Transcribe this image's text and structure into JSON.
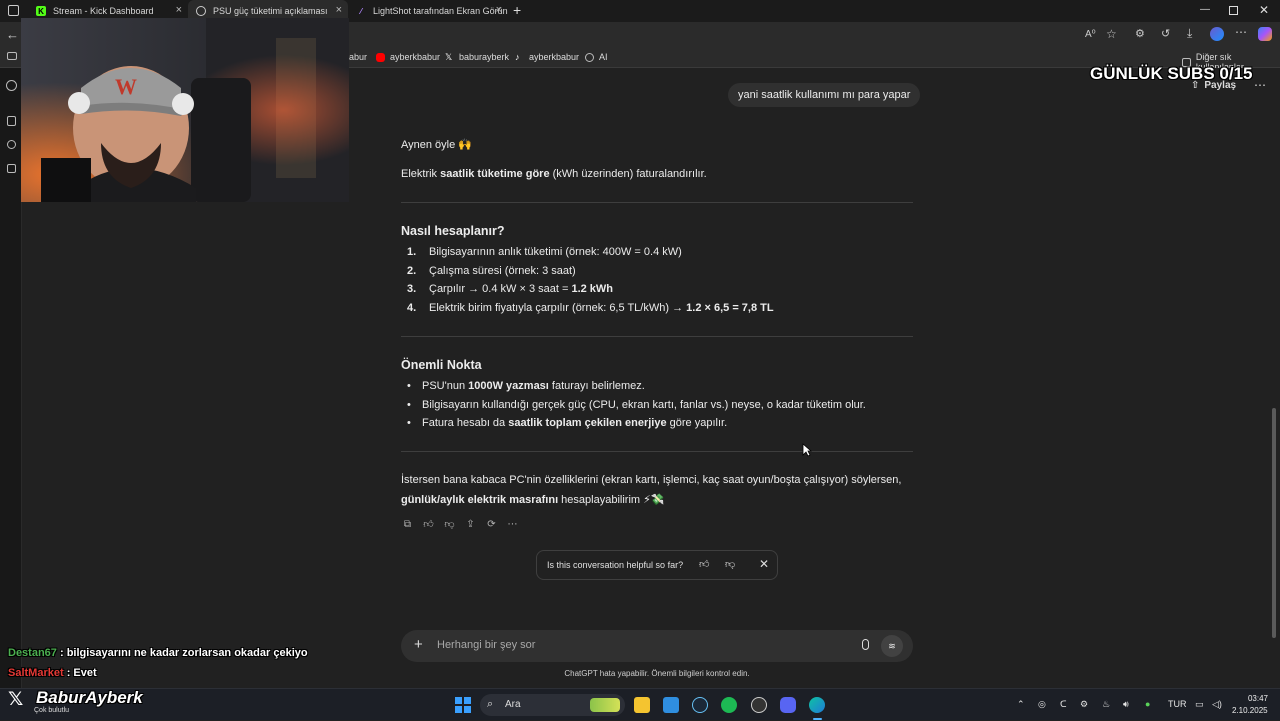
{
  "browser": {
    "tabs": [
      {
        "label": "Stream - Kick Dashboard",
        "icon": "kick-icon"
      },
      {
        "label": "PSU güç tüketimi açıklaması",
        "icon": "chatgpt-icon"
      },
      {
        "label": "LightShot tarafından Ekran Görün",
        "icon": "lightshot-icon"
      }
    ],
    "new_tab_label": "+",
    "favorites": [
      {
        "label": "abur",
        "icon": "kick-icon"
      },
      {
        "label": "ayberkbabur",
        "icon": "youtube-icon"
      },
      {
        "label": "baburayberk",
        "icon": "x-icon"
      },
      {
        "label": "ayberkbabur",
        "icon": "tiktok-icon"
      },
      {
        "label": "AI",
        "icon": "globe-icon"
      }
    ],
    "other_favorites": "Diğer sık kullanılanlar"
  },
  "chat": {
    "share_label": "Paylaş",
    "user_message": "yani saatlik kullanımı mı para yapar",
    "intro_line": "Aynen öyle 🙌",
    "billing_pre": "Elektrik ",
    "billing_bold": "saatlik tüketime göre",
    "billing_post": " (kWh üzerinden) faturalandırılır.",
    "section1_title": "Nasıl hesaplanır?",
    "steps": [
      {
        "num": "1.",
        "text": "Bilgisayarının anlık tüketimi (örnek: 400W = 0.4 kW)",
        "bold": ""
      },
      {
        "num": "2.",
        "text": "Çalışma süresi (örnek: 3 saat)",
        "bold": ""
      },
      {
        "num": "3.",
        "text": "Çarpılır → 0.4 kW × 3 saat = ",
        "bold": "1.2 kWh"
      },
      {
        "num": "4.",
        "text": "Elektrik birim fiyatıyla çarpılır (örnek: 6,5 TL/kWh) → ",
        "bold": "1.2 × 6,5 = 7,8 TL"
      }
    ],
    "section2_title": "Önemli Nokta",
    "bullets": [
      {
        "pre": "PSU'nun ",
        "bold": "1000W yazması",
        "post": " faturayı belirlemez."
      },
      {
        "pre": "Bilgisayarın kullandığı gerçek güç (CPU, ekran kartı, fanlar vs.) neyse, o kadar tüketim olur.",
        "bold": "",
        "post": ""
      },
      {
        "pre": "Fatura hesabı da ",
        "bold": "saatlik toplam çekilen enerjiye",
        "post": " göre yapılır."
      }
    ],
    "closing_line1": "İstersen bana kabaca PC'nin özelliklerini (ekran kartı, işlemci, kaç saat oyun/boşta çalışıyor) söylersen,",
    "closing_bold": "günlük/aylık elektrik masrafını",
    "closing_post": " hesaplayabilirim ⚡💸",
    "feedback_prompt": "Is this conversation helpful so far?",
    "composer_placeholder": "Herhangi bir şey sor",
    "disclaimer": "ChatGPT hata yapabilir. Önemli bilgileri kontrol edin."
  },
  "stream_overlay": {
    "subs_counter": "GÜNLÜK SUBS 0/15",
    "chat_messages": [
      {
        "user": "Destan67",
        "text": " : bilgisayarını ne kadar zorlarsan okadar çekiyo",
        "color": "#4caf50"
      },
      {
        "user": "SaltMarket",
        "text": " : Evet",
        "color": "#e53935"
      }
    ],
    "brand_name": "BaburAyberk",
    "brand_sub": "Çok bulutlu",
    "webcam_cap_letter": "W"
  },
  "taskbar": {
    "search_label": "Ara",
    "language": "TUR",
    "time": "03:47",
    "date": "2.10.2025"
  }
}
